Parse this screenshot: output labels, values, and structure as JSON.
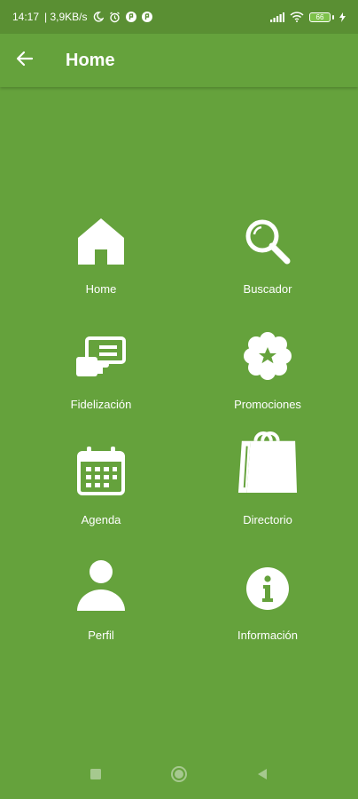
{
  "status_bar": {
    "time": "14:17",
    "speed": "| 3,9KB/s",
    "battery": "66"
  },
  "app_bar": {
    "title": "Home"
  },
  "menu": {
    "items": [
      {
        "label": "Home",
        "icon": "home-icon"
      },
      {
        "label": "Buscador",
        "icon": "search-icon"
      },
      {
        "label": "Fidelización",
        "icon": "card-icon"
      },
      {
        "label": "Promociones",
        "icon": "star-badge-icon"
      },
      {
        "label": "Agenda",
        "icon": "calendar-icon"
      },
      {
        "label": "Directorio",
        "icon": "shopping-bag-icon"
      },
      {
        "label": "Perfil",
        "icon": "person-icon"
      },
      {
        "label": "Información",
        "icon": "info-icon"
      }
    ]
  },
  "colors": {
    "background": "#65a23c",
    "status_bar": "#5a8f33",
    "foreground": "#ffffff"
  }
}
